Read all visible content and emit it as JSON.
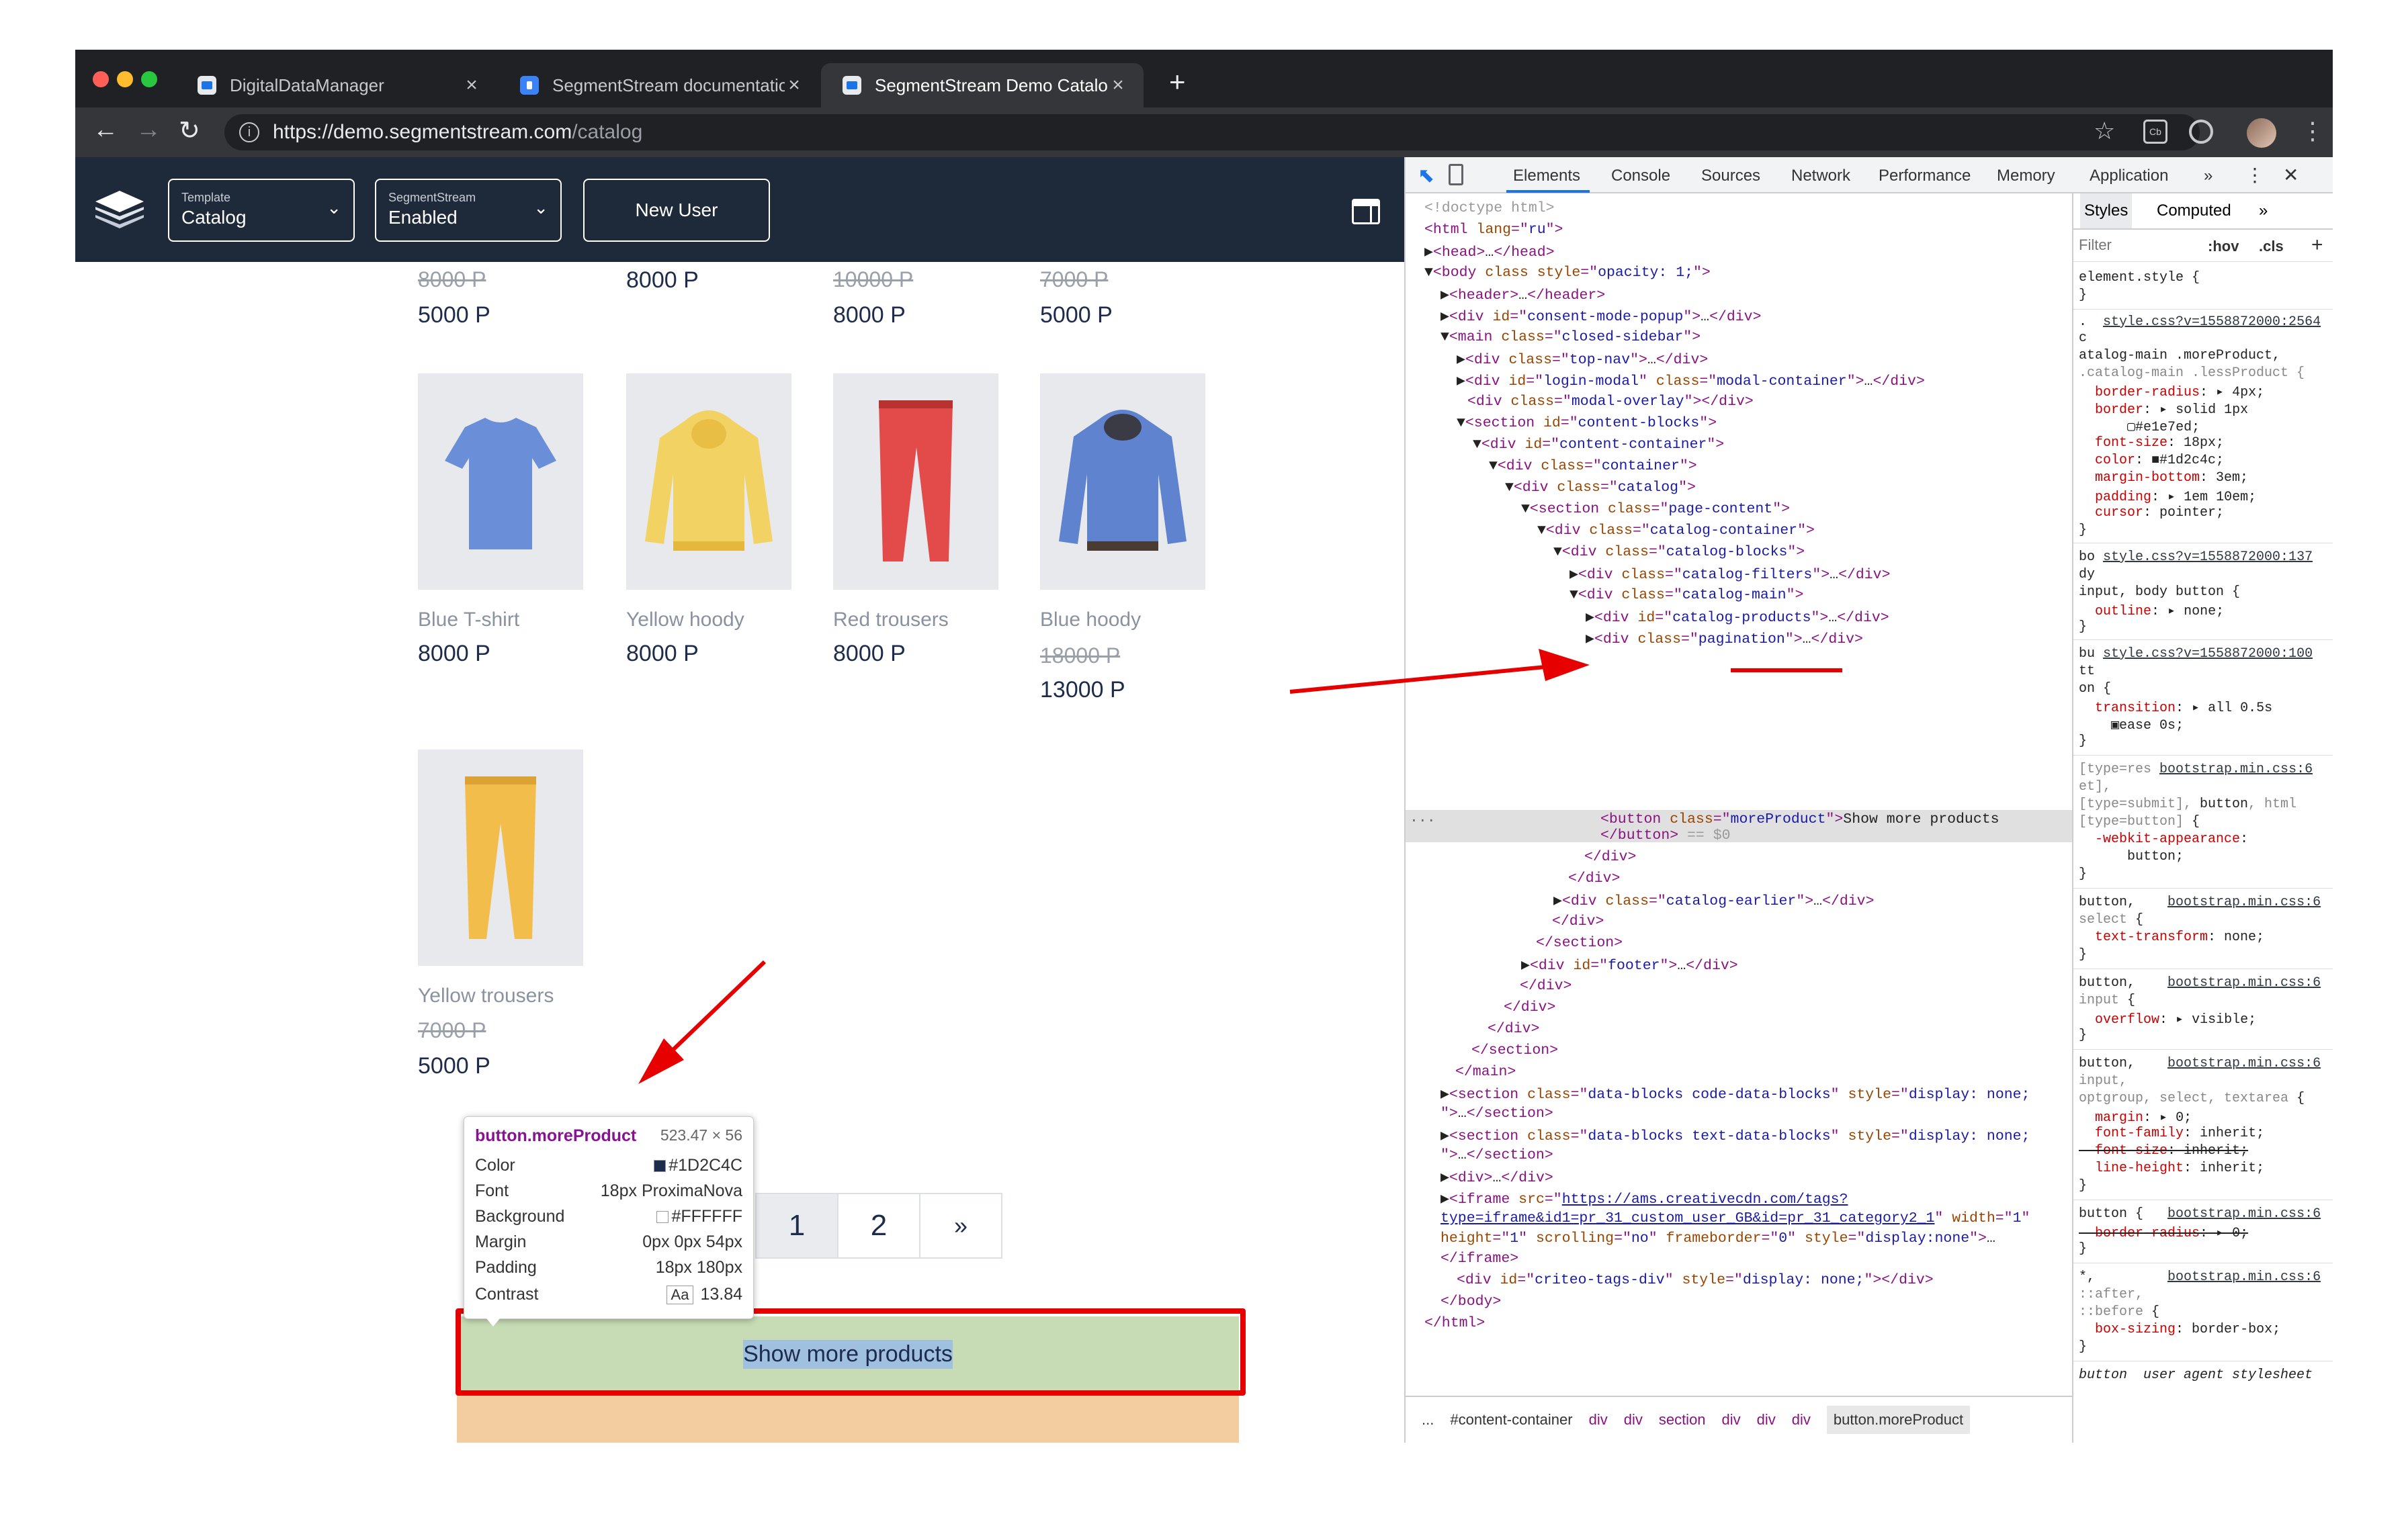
{
  "browser": {
    "tabs": [
      {
        "title": "DigitalDataManager",
        "close": "×"
      },
      {
        "title": "SegmentStream documentatio",
        "close": "×"
      },
      {
        "title": "SegmentStream Demo Catalog",
        "close": "×"
      }
    ],
    "new_tab": "+",
    "url_host": "https://demo.segmentstream.com",
    "url_path": "/catalog",
    "icons": [
      "back-icon",
      "forward-icon",
      "reload-icon",
      "info-icon",
      "star-icon",
      "cast-icon",
      "extension-icon",
      "avatar",
      "menu-icon"
    ]
  },
  "site": {
    "template_caption": "Template",
    "template_value": "Catalog",
    "segmentstream_caption": "SegmentStream",
    "segmentstream_value": "Enabled",
    "new_user_label": "New User",
    "top_row": [
      {
        "old": "8000 P",
        "price": "5000 P"
      },
      {
        "old": "",
        "price": "8000 P"
      },
      {
        "old": "10000 P",
        "price": "8000 P"
      },
      {
        "old": "7000 P",
        "price": "5000 P"
      }
    ],
    "products": [
      {
        "name": "Blue T-shirt",
        "old": "",
        "price": "8000 P",
        "color": "#6a8fd8"
      },
      {
        "name": "Yellow hoody",
        "old": "",
        "price": "8000 P",
        "color": "#f3d264"
      },
      {
        "name": "Red trousers",
        "old": "",
        "price": "8000 P",
        "color": "#e34b4b"
      },
      {
        "name": "Blue hoody",
        "old": "18000 P",
        "price": "13000 P",
        "color": "#5f83cf"
      },
      {
        "name": "Yellow trousers",
        "old": "7000 P",
        "price": "5000 P",
        "color": "#f2bd4b"
      }
    ],
    "pagination": [
      "1",
      "2",
      "»"
    ],
    "more_button_label": "Show more products",
    "tooltip": {
      "selector": "button.moreProduct",
      "dimensions": "523.47 × 56",
      "rows": [
        {
          "label": "Color",
          "value": "#1D2C4C"
        },
        {
          "label": "Font",
          "value": "18px ProximaNova"
        },
        {
          "label": "Background",
          "value": "#FFFFFF"
        },
        {
          "label": "Margin",
          "value": "0px 0px 54px"
        },
        {
          "label": "Padding",
          "value": "18px 180px"
        },
        {
          "label": "Contrast",
          "value": "13.84",
          "badge": "Aa"
        }
      ]
    }
  },
  "devtools": {
    "tabs": [
      "Elements",
      "Console",
      "Sources",
      "Network",
      "Performance",
      "Memory",
      "Application"
    ],
    "more": "»",
    "active_tab": "Elements",
    "styles_tabs": [
      "Styles",
      "Computed"
    ],
    "filter_placeholder": "Filter",
    "filter_hov": ":hov",
    "filter_cls": ".cls",
    "filter_add": "+",
    "ellipsis": "...",
    "breadcrumbs": [
      "...",
      "#content-container",
      "div",
      "div",
      "section",
      "div",
      "div",
      "div",
      "button.moreProduct"
    ],
    "colors": {
      "tag": "#881280",
      "attr": "#994500",
      "value": "#1a1aa6",
      "highlight": "#e60000"
    }
  }
}
